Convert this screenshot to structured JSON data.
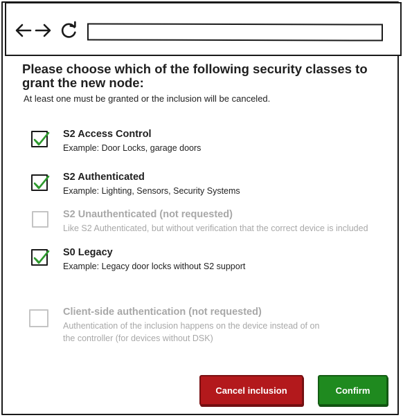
{
  "browser": {
    "back_icon": "arrow-left-icon",
    "forward_icon": "arrow-right-icon",
    "reload_icon": "reload-icon",
    "url_value": ""
  },
  "dialog": {
    "heading": "Please choose which of the following security classes to grant the new node:",
    "subheading": "At least one must be granted or the inclusion will be canceled.",
    "options": [
      {
        "title": "S2 Access Control",
        "description": "Example: Door Locks, garage doors",
        "checked": true,
        "disabled": false
      },
      {
        "title": "S2 Authenticated",
        "description": "Example: Lighting, Sensors, Security Systems",
        "checked": true,
        "disabled": false
      },
      {
        "title": "S2 Unauthenticated (not requested)",
        "description": "Like S2 Authenticated, but without verification that the correct device is included",
        "checked": false,
        "disabled": true
      },
      {
        "title": "S0 Legacy",
        "description": "Example: Legacy door locks without S2 support",
        "checked": true,
        "disabled": false
      },
      {
        "title": "Client-side authentication (not requested)",
        "description": "Authentication of the inclusion happens on the device instead of on the controller (for devices without DSK)",
        "checked": false,
        "disabled": true
      }
    ],
    "cancel_label": "Cancel inclusion",
    "confirm_label": "Confirm"
  },
  "colors": {
    "cancel": "#b3191c",
    "confirm": "#1f8a1f",
    "check": "#2e9a2e",
    "disabled_text": "#a8a8a8"
  }
}
